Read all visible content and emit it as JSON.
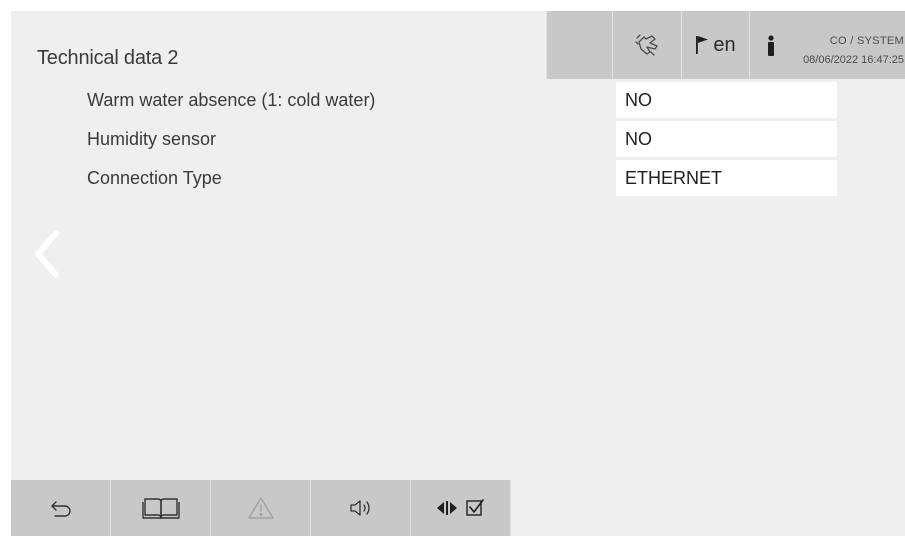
{
  "header": {
    "title": "Technical data 2",
    "touch_icon": "hand-touch-icon",
    "language": {
      "icon": "flag-icon",
      "code": "en"
    },
    "user": {
      "icon": "person-icon",
      "name": "CO / SYSTEM",
      "datetime": "08/06/2022 16:47:25"
    }
  },
  "rows": [
    {
      "label": "Warm water absence (1: cold water)",
      "value": "NO"
    },
    {
      "label": "Humidity sensor",
      "value": "NO"
    },
    {
      "label": "Connection Type",
      "value": "ETHERNET"
    }
  ],
  "nav": {
    "back_icon": "chevron-left-icon"
  },
  "footer": {
    "buttons": [
      {
        "icon": "undo-arrow-icon"
      },
      {
        "icon": "book-icon"
      },
      {
        "icon": "warning-triangle-icon"
      },
      {
        "icon": "speaker-icon"
      },
      {
        "icon": "arrows-checkbox-icon"
      }
    ]
  },
  "colors": {
    "background": "#efefef",
    "panel": "#c8c8c8",
    "field": "#ffffff",
    "text": "#3a3a3a"
  }
}
